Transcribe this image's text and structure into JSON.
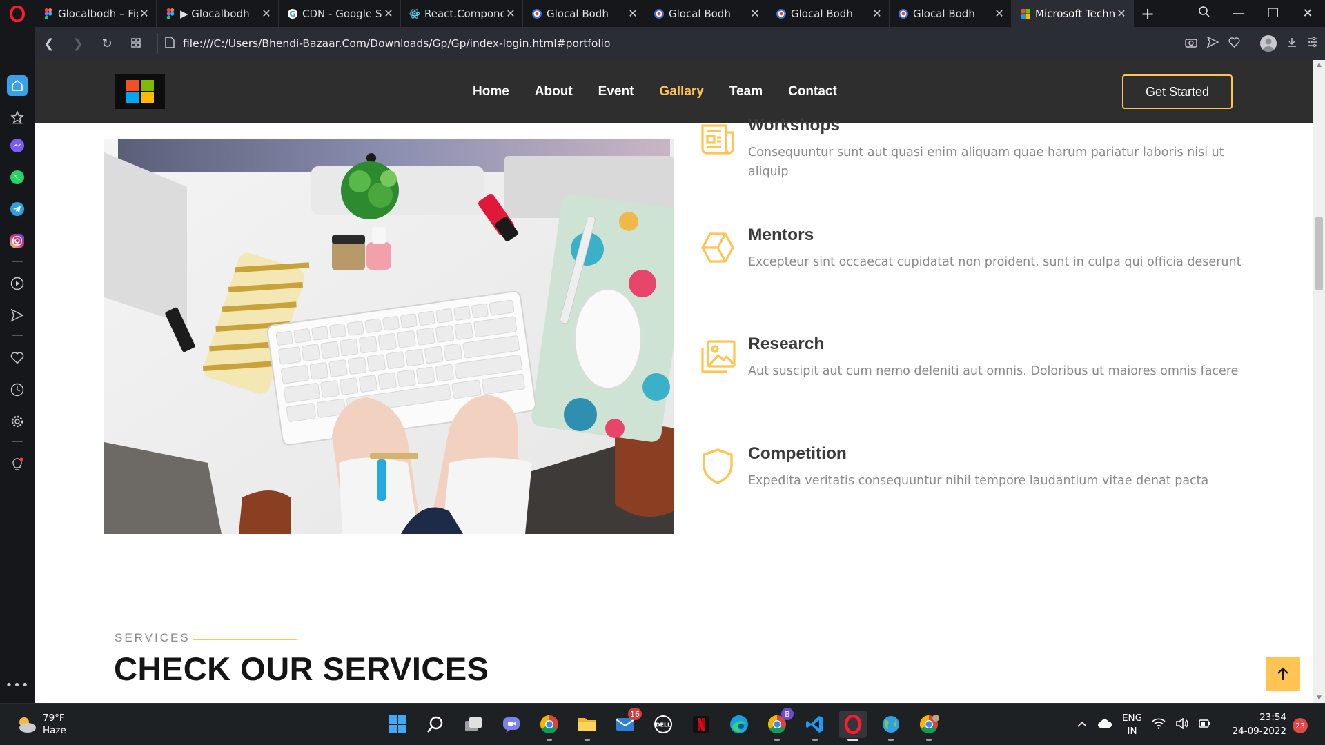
{
  "browser": {
    "tabs": [
      {
        "title": "Glocalbodh – Figma",
        "favicon": "figma-icon",
        "active": false
      },
      {
        "title": "▶ Glocalbodh",
        "favicon": "figma-icon",
        "active": false
      },
      {
        "title": "CDN - Google Search",
        "favicon": "google-icon",
        "active": false
      },
      {
        "title": "React.Component",
        "favicon": "react-icon",
        "active": false
      },
      {
        "title": "Glocal Bodh",
        "favicon": "target-icon",
        "active": false
      },
      {
        "title": "Glocal Bodh",
        "favicon": "target-icon",
        "active": false
      },
      {
        "title": "Glocal Bodh",
        "favicon": "target-icon",
        "active": false
      },
      {
        "title": "Glocal Bodh",
        "favicon": "target-icon",
        "active": false
      },
      {
        "title": "Microsoft Technical",
        "favicon": "windows-icon",
        "active": true
      }
    ],
    "url": "file:///C:/Users/Bhendi-Bazaar.Com/Downloads/Gp/Gp/index-login.html#portfolio"
  },
  "site": {
    "nav": [
      {
        "label": "Home",
        "active": false
      },
      {
        "label": "About",
        "active": false
      },
      {
        "label": "Event",
        "active": false
      },
      {
        "label": "Gallary",
        "active": true
      },
      {
        "label": "Team",
        "active": false
      },
      {
        "label": "Contact",
        "active": false
      }
    ],
    "cta": "Get Started",
    "accent": "#ffc451",
    "features": [
      {
        "icon": "document-icon",
        "title": "Workshops",
        "text": "Consequuntur sunt aut quasi enim aliquam quae harum pariatur laboris nisi ut aliquip"
      },
      {
        "icon": "hexagon-icon",
        "title": "Mentors",
        "text": "Excepteur sint occaecat cupidatat non proident, sunt in culpa qui officia deserunt"
      },
      {
        "icon": "images-icon",
        "title": "Research",
        "text": "Aut suscipit aut cum nemo deleniti aut omnis. Doloribus ut maiores omnis facere"
      },
      {
        "icon": "shield-icon",
        "title": "Competition",
        "text": "Expedita veritatis consequuntur nihil tempore laudantium vitae denat pacta"
      }
    ],
    "services_label": "SERVICES",
    "services_title": "CHECK OUR SERVICES"
  },
  "taskbar": {
    "weather_temp": "79°F",
    "weather_desc": "Haze",
    "mail_badge": "16",
    "chrome_profile_badge": "B",
    "lang_primary": "ENG",
    "lang_secondary": "IN",
    "time": "23:54",
    "date": "24-09-2022",
    "notifications": "23"
  }
}
